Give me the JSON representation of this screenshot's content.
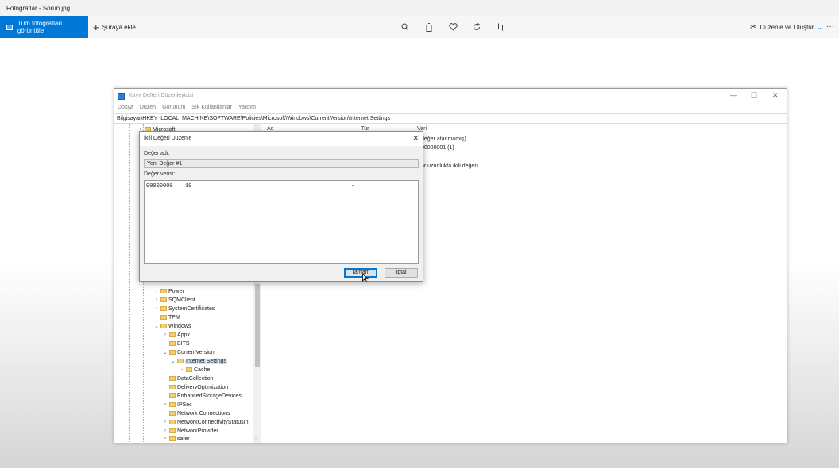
{
  "app": {
    "title": "Fotoğraflar - Sorun.jpg",
    "all_photos_label": "Tüm fotoğrafları görüntüle",
    "add_label": "Şuraya ekle",
    "edit_create_label": "Düzenle ve Oluştur",
    "toolbar_icons": [
      "zoom-icon",
      "delete-icon",
      "favorite-icon",
      "rotate-icon",
      "crop-icon"
    ],
    "accent_color": "#0078d7"
  },
  "regedit": {
    "title": "Kayıt Defteri Düzenleyicisi",
    "menu": [
      "Dosya",
      "Düzen",
      "Görünüm",
      "Sık Kullanılanlar",
      "Yardım"
    ],
    "address": "Bilgisayar\\HKEY_LOCAL_MACHINE\\SOFTWARE\\Policies\\Microsoft\\Windows\\CurrentVersion\\Internet Settings",
    "tree": [
      "Microsoft",
      "Power",
      "SQMClient",
      "SystemCertificates",
      "TPM",
      "Windows",
      "Appx",
      "BITS",
      "CurrentVersion",
      "Internet Settings",
      "Cache",
      "DataCollection",
      "DeliveryOptimization",
      "EnhancedStorageDevices",
      "IPSec",
      "Network Connections",
      "NetworkConnectivityStatusIn",
      "NetworkProvider",
      "safer"
    ],
    "columns": {
      "name": "Ad",
      "type": "Tür",
      "data": "Veri"
    },
    "value_fragments": [
      "değer atanmamış)",
      "00000001 (1)",
      "hr uzunlukta ikili değer)"
    ]
  },
  "dialog": {
    "title": "İkili Değeri Düzenle",
    "name_label": "Değer adı:",
    "name_value": "Yeni Değer #1",
    "data_label": "Değer verisi:",
    "data_offset": "00000000",
    "data_bytes": "10",
    "data_sep": "-",
    "ok_label": "Tamam",
    "cancel_label": "İptal"
  }
}
